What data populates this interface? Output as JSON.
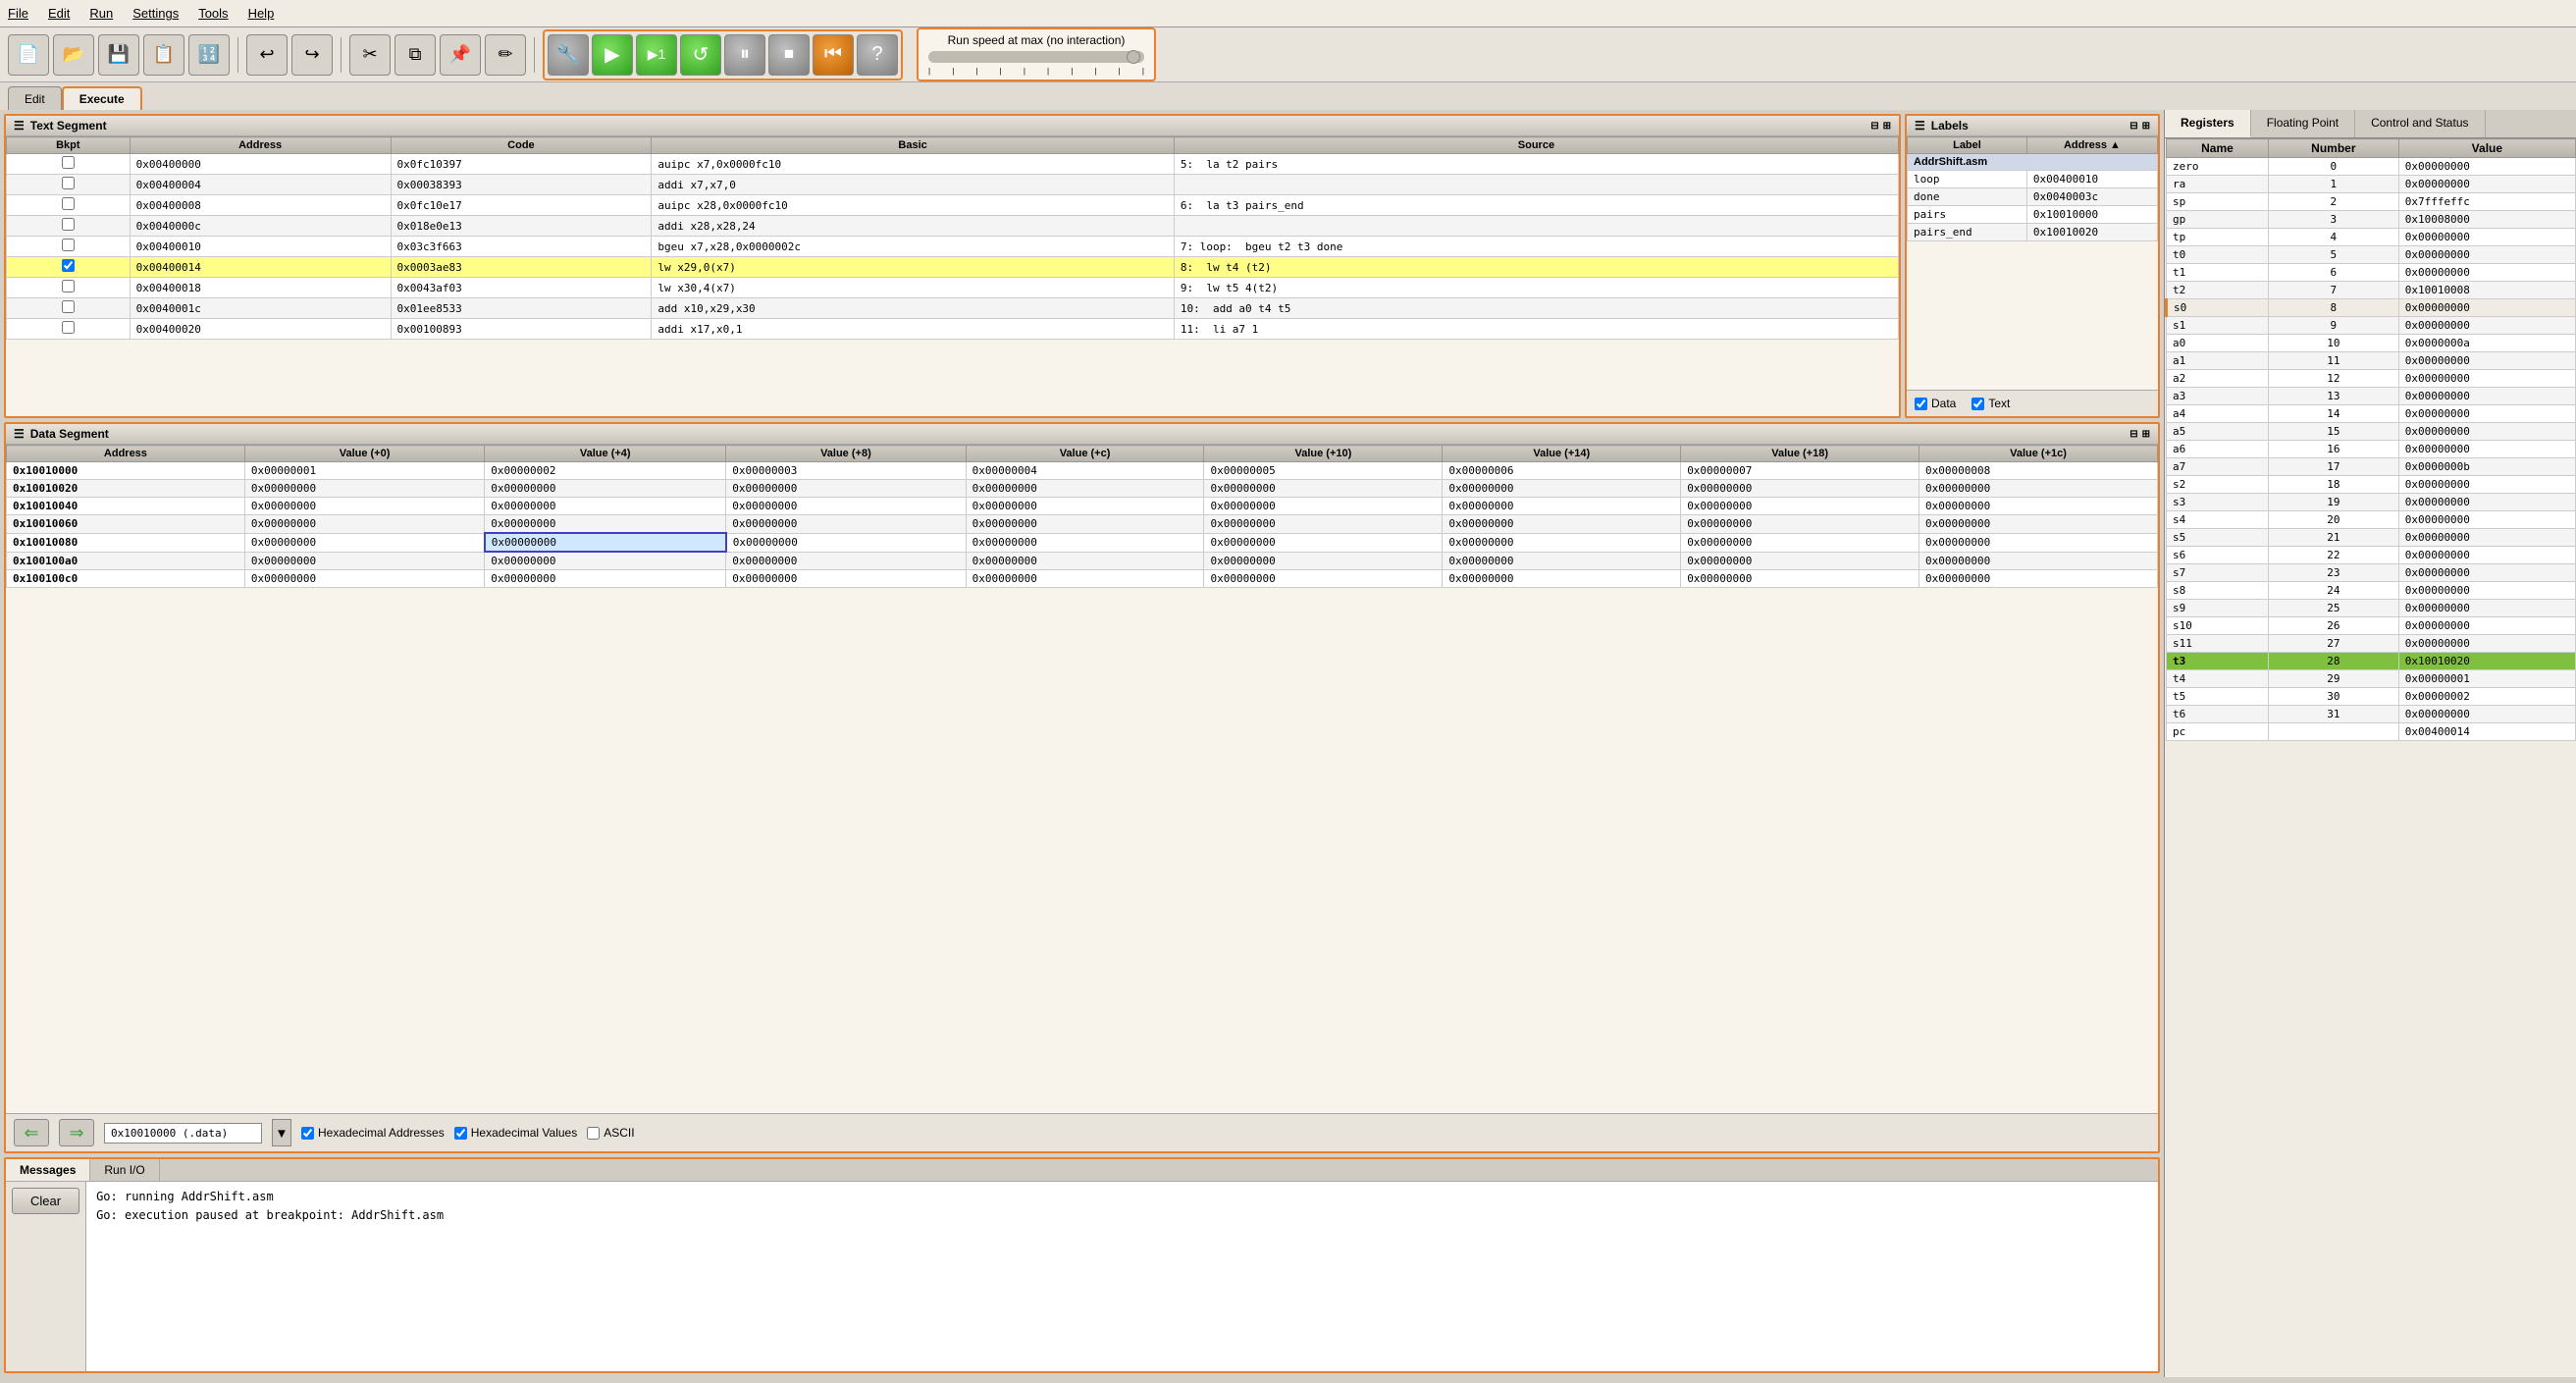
{
  "menu": {
    "items": [
      "File",
      "Edit",
      "Run",
      "Settings",
      "Tools",
      "Help"
    ]
  },
  "toolbar": {
    "buttons": [
      {
        "name": "new",
        "icon": "📄"
      },
      {
        "name": "open",
        "icon": "📂"
      },
      {
        "name": "save",
        "icon": "💾"
      },
      {
        "name": "save-as",
        "icon": "📋"
      },
      {
        "name": "dump",
        "icon": "🔢"
      },
      {
        "name": "undo",
        "icon": "↩"
      },
      {
        "name": "redo",
        "icon": "↪"
      },
      {
        "name": "cut",
        "icon": "✂"
      },
      {
        "name": "copy",
        "icon": "⧉"
      },
      {
        "name": "paste",
        "icon": "📌"
      },
      {
        "name": "find",
        "icon": "✏"
      }
    ],
    "run_buttons": [
      {
        "name": "assemble",
        "icon": "🔧",
        "style": "gray"
      },
      {
        "name": "run",
        "icon": "▶",
        "style": "green"
      },
      {
        "name": "step",
        "icon": "▶₁",
        "style": "green"
      },
      {
        "name": "backstep",
        "icon": "↺",
        "style": "green"
      },
      {
        "name": "pause",
        "icon": "⏸",
        "style": "gray"
      },
      {
        "name": "stop",
        "icon": "⏹",
        "style": "gray"
      },
      {
        "name": "reset",
        "icon": "⏮",
        "style": "orange"
      },
      {
        "name": "help",
        "icon": "?",
        "style": "gray"
      }
    ],
    "speed_label": "Run speed at max (no interaction)",
    "speed_ticks": [
      "1",
      "",
      "",
      "",
      "",
      "",
      "",
      "",
      "",
      ""
    ]
  },
  "tabs": {
    "edit_label": "Edit",
    "execute_label": "Execute",
    "active": "Execute"
  },
  "text_segment": {
    "title": "Text Segment",
    "columns": [
      "Bkpt",
      "Address",
      "Code",
      "Basic",
      "Source"
    ],
    "rows": [
      {
        "bkpt": false,
        "address": "0x00400000",
        "code": "0x0fc10397",
        "basic": "auipc x7,0x0000fc10",
        "line": "5:",
        "src": "la    t2 pairs"
      },
      {
        "bkpt": false,
        "address": "0x00400004",
        "code": "0x00038393",
        "basic": "addi x7,x7,0",
        "line": "",
        "src": ""
      },
      {
        "bkpt": false,
        "address": "0x00400008",
        "code": "0x0fc10e17",
        "basic": "auipc x28,0x0000fc10",
        "line": "6:",
        "src": "la    t3 pairs_end"
      },
      {
        "bkpt": false,
        "address": "0x0040000c",
        "code": "0x018e0e13",
        "basic": "addi x28,x28,24",
        "line": "",
        "src": ""
      },
      {
        "bkpt": false,
        "address": "0x00400010",
        "code": "0x03c3f663",
        "basic": "bgeu x7,x28,0x0000002c",
        "line": "7: loop:",
        "src": "bgeu  t2 t3 done"
      },
      {
        "bkpt": true,
        "address": "0x00400014",
        "code": "0x0003ae83",
        "basic": "lw x29,0(x7)",
        "line": "8:",
        "src": "lw    t4 (t2)",
        "highlight": true
      },
      {
        "bkpt": false,
        "address": "0x00400018",
        "code": "0x0043af03",
        "basic": "lw x30,4(x7)",
        "line": "9:",
        "src": "lw    t5 4(t2)"
      },
      {
        "bkpt": false,
        "address": "0x0040001c",
        "code": "0x01ee8533",
        "basic": "add x10,x29,x30",
        "line": "10:",
        "src": "add   a0 t4 t5"
      },
      {
        "bkpt": false,
        "address": "0x00400020",
        "code": "0x00100893",
        "basic": "addi x17,x0,1",
        "line": "11:",
        "src": "li    a7 1"
      }
    ]
  },
  "labels": {
    "title": "Labels",
    "columns": [
      "Label",
      "Address ▲"
    ],
    "filename": "AddrShift.asm",
    "rows": [
      {
        "label": "loop",
        "address": "0x00400010"
      },
      {
        "label": "done",
        "address": "0x0040003c"
      },
      {
        "label": "pairs",
        "address": "0x10010000"
      },
      {
        "label": "pairs_end",
        "address": "0x10010020"
      }
    ],
    "checkboxes": [
      {
        "label": "Data",
        "checked": true
      },
      {
        "label": "Text",
        "checked": true
      }
    ]
  },
  "data_segment": {
    "title": "Data Segment",
    "columns": [
      "Address",
      "Value (+0)",
      "Value (+4)",
      "Value (+8)",
      "Value (+c)",
      "Value (+10)",
      "Value (+14)",
      "Value (+18)",
      "Value (+1c)"
    ],
    "rows": [
      {
        "addr": "0x10010000",
        "vals": [
          "0x00000001",
          "0x00000002",
          "0x00000003",
          "0x00000004",
          "0x00000005",
          "0x00000006",
          "0x00000007",
          "0x00000008"
        ]
      },
      {
        "addr": "0x10010020",
        "vals": [
          "0x00000000",
          "0x00000000",
          "0x00000000",
          "0x00000000",
          "0x00000000",
          "0x00000000",
          "0x00000000",
          "0x00000000"
        ]
      },
      {
        "addr": "0x10010040",
        "vals": [
          "0x00000000",
          "0x00000000",
          "0x00000000",
          "0x00000000",
          "0x00000000",
          "0x00000000",
          "0x00000000",
          "0x00000000"
        ]
      },
      {
        "addr": "0x10010060",
        "vals": [
          "0x00000000",
          "0x00000000",
          "0x00000000",
          "0x00000000",
          "0x00000000",
          "0x00000000",
          "0x00000000",
          "0x00000000"
        ]
      },
      {
        "addr": "0x10010080",
        "vals": [
          "0x00000000",
          "0x00000000",
          "0x00000000",
          "0x00000000",
          "0x00000000",
          "0x00000000",
          "0x00000000",
          "0x00000000"
        ],
        "highlight_col": 2
      },
      {
        "addr": "0x100100a0",
        "vals": [
          "0x00000000",
          "0x00000000",
          "0x00000000",
          "0x00000000",
          "0x00000000",
          "0x00000000",
          "0x00000000",
          "0x00000000"
        ]
      },
      {
        "addr": "0x100100c0",
        "vals": [
          "0x00000000",
          "0x00000000",
          "0x00000000",
          "0x00000000",
          "0x00000000",
          "0x00000000",
          "0x00000000",
          "0x00000000"
        ]
      }
    ],
    "nav": {
      "prev_label": "◀",
      "next_label": "▶",
      "address_value": "0x10010000 (.data)",
      "hex_addresses": true,
      "hex_values": true,
      "ascii": false
    },
    "checkbox_labels": [
      "Hexadecimal Addresses",
      "Hexadecimal Values",
      "ASCII"
    ]
  },
  "registers": {
    "tabs": [
      "Registers",
      "Floating Point",
      "Control and Status"
    ],
    "active_tab": "Registers",
    "columns": [
      "Name",
      "Number",
      "Value"
    ],
    "rows": [
      {
        "name": "zero",
        "num": 0,
        "val": "0x00000000"
      },
      {
        "name": "ra",
        "num": 1,
        "val": "0x00000000"
      },
      {
        "name": "sp",
        "num": 2,
        "val": "0x7fffeffc"
      },
      {
        "name": "gp",
        "num": 3,
        "val": "0x10008000"
      },
      {
        "name": "tp",
        "num": 4,
        "val": "0x00000000"
      },
      {
        "name": "t0",
        "num": 5,
        "val": "0x00000000"
      },
      {
        "name": "t1",
        "num": 6,
        "val": "0x00000000"
      },
      {
        "name": "t2",
        "num": 7,
        "val": "0x10010008"
      },
      {
        "name": "s0",
        "num": 8,
        "val": "0x00000000",
        "highlight_s0": true
      },
      {
        "name": "s1",
        "num": 9,
        "val": "0x00000000"
      },
      {
        "name": "a0",
        "num": 10,
        "val": "0x0000000a"
      },
      {
        "name": "a1",
        "num": 11,
        "val": "0x00000000"
      },
      {
        "name": "a2",
        "num": 12,
        "val": "0x00000000"
      },
      {
        "name": "a3",
        "num": 13,
        "val": "0x00000000"
      },
      {
        "name": "a4",
        "num": 14,
        "val": "0x00000000"
      },
      {
        "name": "a5",
        "num": 15,
        "val": "0x00000000"
      },
      {
        "name": "a6",
        "num": 16,
        "val": "0x00000000"
      },
      {
        "name": "a7",
        "num": 17,
        "val": "0x0000000b"
      },
      {
        "name": "s2",
        "num": 18,
        "val": "0x00000000"
      },
      {
        "name": "s3",
        "num": 19,
        "val": "0x00000000"
      },
      {
        "name": "s4",
        "num": 20,
        "val": "0x00000000"
      },
      {
        "name": "s5",
        "num": 21,
        "val": "0x00000000"
      },
      {
        "name": "s6",
        "num": 22,
        "val": "0x00000000"
      },
      {
        "name": "s7",
        "num": 23,
        "val": "0x00000000"
      },
      {
        "name": "s8",
        "num": 24,
        "val": "0x00000000"
      },
      {
        "name": "s9",
        "num": 25,
        "val": "0x00000000"
      },
      {
        "name": "s10",
        "num": 26,
        "val": "0x00000000"
      },
      {
        "name": "s11",
        "num": 27,
        "val": "0x00000000"
      },
      {
        "name": "t3",
        "num": 28,
        "val": "0x10010020",
        "highlight": true
      },
      {
        "name": "t4",
        "num": 29,
        "val": "0x00000001"
      },
      {
        "name": "t5",
        "num": 30,
        "val": "0x00000002"
      },
      {
        "name": "t6",
        "num": 31,
        "val": "0x00000000"
      },
      {
        "name": "pc",
        "num": "",
        "val": "0x00400014"
      }
    ]
  },
  "messages": {
    "tabs": [
      "Messages",
      "Run I/O"
    ],
    "active_tab": "Messages",
    "lines": [
      "",
      "Go: running AddrShift.asm",
      "",
      "Go: execution paused at breakpoint: AddrShift.asm"
    ],
    "clear_label": "Clear"
  }
}
